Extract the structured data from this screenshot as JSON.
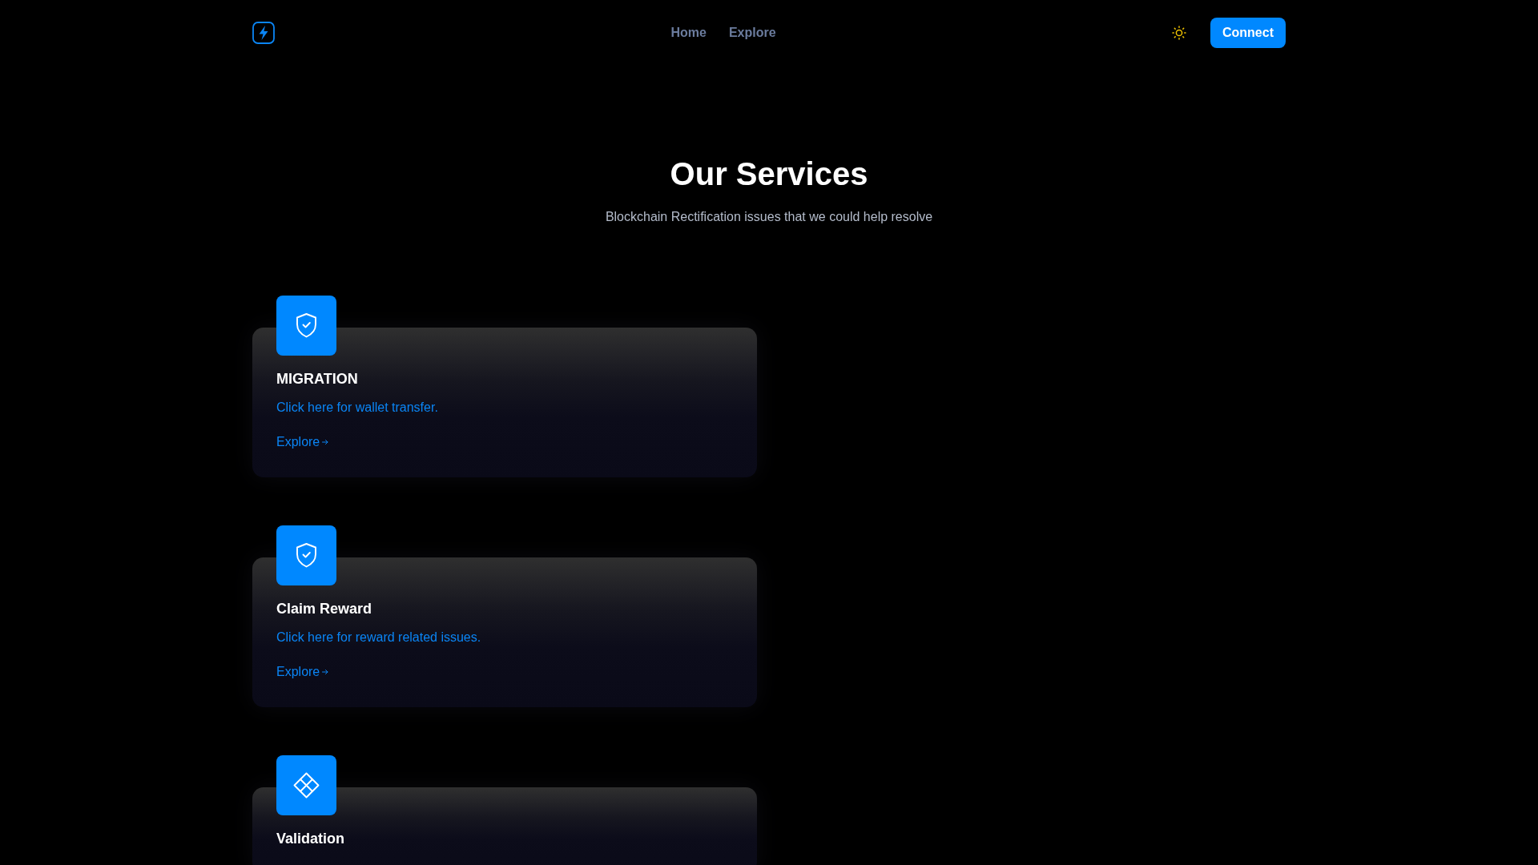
{
  "header": {
    "nav": [
      {
        "label": "Home"
      },
      {
        "label": "Explore"
      }
    ],
    "connect_button": "Connect"
  },
  "hero": {
    "title": "Our Services",
    "subtitle": "Blockchain Rectification issues that we could help resolve"
  },
  "services": [
    {
      "kind": "shield",
      "title": "MIGRATION",
      "description": "Click here for wallet transfer.",
      "link": "Explore"
    },
    {
      "kind": "shield",
      "title": "Claim Reward",
      "description": "Click here for reward related issues.",
      "link": "Explore"
    },
    {
      "kind": "diamond",
      "title": "Validation"
    }
  ]
}
